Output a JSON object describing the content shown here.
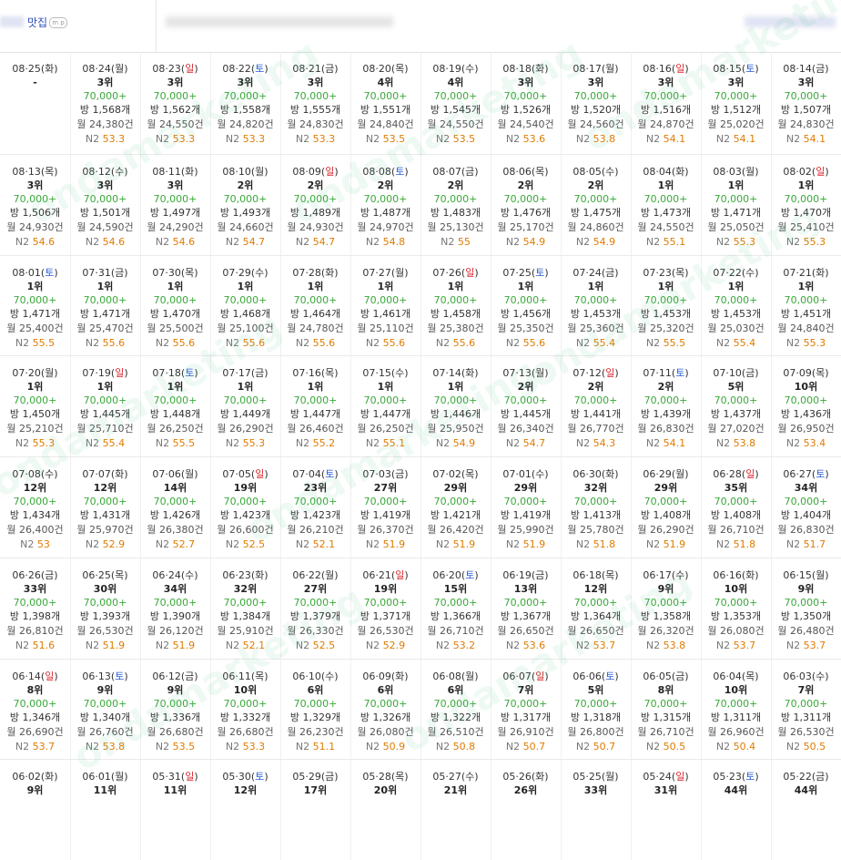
{
  "header": {
    "title": "맛집",
    "badge": "m p"
  },
  "first_row": [
    {
      "date": "08·25(화)",
      "wd": "",
      "rank": "-"
    },
    {
      "date": "08·24(월)",
      "wd": "",
      "rank": "3위",
      "price": "70,000+",
      "bang": "방 1,568개",
      "month": "월 24,380건",
      "n2": "53.3"
    },
    {
      "date": "08·23(",
      "wday": "일",
      ")": ")",
      "wd": "sun",
      "rank": "3위",
      "price": "70,000+",
      "bang": "방 1,562개",
      "month": "월 24,550건",
      "n2": "53.3"
    },
    {
      "date": "08·22(",
      "wday": "토",
      "wd": "sat",
      "rank": "3위",
      "price": "70,000+",
      "bang": "방 1,558개",
      "month": "월 24,820건",
      "n2": "53.3"
    },
    {
      "date": "08·21(금)",
      "wd": "",
      "rank": "3위",
      "price": "70,000+",
      "bang": "방 1,555개",
      "month": "월 24,830건",
      "n2": "53.3"
    },
    {
      "date": "08·20(목)",
      "wd": "",
      "rank": "4위",
      "price": "70,000+",
      "bang": "방 1,551개",
      "month": "월 24,840건",
      "n2": "53.5"
    },
    {
      "date": "08·19(수)",
      "wd": "",
      "rank": "4위",
      "price": "70,000+",
      "bang": "방 1,545개",
      "month": "월 24,550건",
      "n2": "53.5"
    },
    {
      "date": "08·18(화)",
      "wd": "",
      "rank": "3위",
      "price": "70,000+",
      "bang": "방 1,526개",
      "month": "월 24,540건",
      "n2": "53.6"
    },
    {
      "date": "08·17(월)",
      "wd": "",
      "rank": "3위",
      "price": "70,000+",
      "bang": "방 1,520개",
      "month": "월 24,560건",
      "n2": "53.8"
    },
    {
      "date": "08·16(",
      "wday": "일",
      "wd": "sun",
      "rank": "3위",
      "price": "70,000+",
      "bang": "방 1,516개",
      "month": "월 24,870건",
      "n2": "54.1"
    },
    {
      "date": "08·15(",
      "wday": "토",
      "wd": "sat",
      "rank": "3위",
      "price": "70,000+",
      "bang": "방 1,512개",
      "month": "월 25,020건",
      "n2": "54.1"
    },
    {
      "date": "08·14(금)",
      "wd": "",
      "rank": "3위",
      "price": "70,000+",
      "bang": "방 1,507개",
      "month": "월 24,830건",
      "n2": "54.1"
    }
  ],
  "rows": [
    [
      {
        "d": "08·13(목)",
        "w": "",
        "r": "3위",
        "b": "방 1,506개",
        "m": "월 24,930건",
        "n": "54.6"
      },
      {
        "d": "08·12(수)",
        "w": "",
        "r": "3위",
        "b": "방 1,501개",
        "m": "월 24,590건",
        "n": "54.6"
      },
      {
        "d": "08·11(화)",
        "w": "",
        "r": "3위",
        "b": "방 1,497개",
        "m": "월 24,290건",
        "n": "54.6"
      },
      {
        "d": "08·10(월)",
        "w": "",
        "r": "2위",
        "b": "방 1,493개",
        "m": "월 24,660건",
        "n": "54.7"
      },
      {
        "d": "08·09(",
        "w": "sun",
        "r": "2위",
        "b": "방 1,489개",
        "m": "월 24,930건",
        "n": "54.7"
      },
      {
        "d": "08·08(",
        "w": "sat",
        "r": "2위",
        "b": "방 1,487개",
        "m": "월 24,970건",
        "n": "54.8"
      },
      {
        "d": "08·07(금)",
        "w": "",
        "r": "2위",
        "b": "방 1,483개",
        "m": "월 25,130건",
        "n": "55"
      },
      {
        "d": "08·06(목)",
        "w": "",
        "r": "2위",
        "b": "방 1,476개",
        "m": "월 25,170건",
        "n": "54.9"
      },
      {
        "d": "08·05(수)",
        "w": "",
        "r": "2위",
        "b": "방 1,475개",
        "m": "월 24,860건",
        "n": "54.9"
      },
      {
        "d": "08·04(화)",
        "w": "",
        "r": "1위",
        "b": "방 1,473개",
        "m": "월 24,550건",
        "n": "55.1"
      },
      {
        "d": "08·03(월)",
        "w": "",
        "r": "1위",
        "b": "방 1,471개",
        "m": "월 25,050건",
        "n": "55.3"
      },
      {
        "d": "08·02(",
        "w": "sun",
        "r": "1위",
        "b": "방 1,470개",
        "m": "월 25,410건",
        "n": "55.3"
      }
    ],
    [
      {
        "d": "08·01(",
        "w": "sat",
        "r": "1위",
        "b": "방 1,471개",
        "m": "월 25,400건",
        "n": "55.5"
      },
      {
        "d": "07·31(금)",
        "w": "",
        "r": "1위",
        "b": "방 1,471개",
        "m": "월 25,470건",
        "n": "55.6"
      },
      {
        "d": "07·30(목)",
        "w": "",
        "r": "1위",
        "b": "방 1,470개",
        "m": "월 25,500건",
        "n": "55.6"
      },
      {
        "d": "07·29(수)",
        "w": "",
        "r": "1위",
        "b": "방 1,468개",
        "m": "월 25,100건",
        "n": "55.6"
      },
      {
        "d": "07·28(화)",
        "w": "",
        "r": "1위",
        "b": "방 1,464개",
        "m": "월 24,780건",
        "n": "55.6"
      },
      {
        "d": "07·27(월)",
        "w": "",
        "r": "1위",
        "b": "방 1,461개",
        "m": "월 25,110건",
        "n": "55.6"
      },
      {
        "d": "07·26(",
        "w": "sun",
        "r": "1위",
        "b": "방 1,458개",
        "m": "월 25,380건",
        "n": "55.6"
      },
      {
        "d": "07·25(",
        "w": "sat",
        "r": "1위",
        "b": "방 1,456개",
        "m": "월 25,350건",
        "n": "55.6"
      },
      {
        "d": "07·24(금)",
        "w": "",
        "r": "1위",
        "b": "방 1,453개",
        "m": "월 25,360건",
        "n": "55.4"
      },
      {
        "d": "07·23(목)",
        "w": "",
        "r": "1위",
        "b": "방 1,453개",
        "m": "월 25,320건",
        "n": "55.5"
      },
      {
        "d": "07·22(수)",
        "w": "",
        "r": "1위",
        "b": "방 1,453개",
        "m": "월 25,030건",
        "n": "55.4"
      },
      {
        "d": "07·21(화)",
        "w": "",
        "r": "1위",
        "b": "방 1,451개",
        "m": "월 24,840건",
        "n": "55.3"
      }
    ],
    [
      {
        "d": "07·20(월)",
        "w": "",
        "r": "1위",
        "b": "방 1,450개",
        "m": "월 25,210건",
        "n": "55.3"
      },
      {
        "d": "07·19(",
        "w": "sun",
        "r": "1위",
        "b": "방 1,445개",
        "m": "월 25,710건",
        "n": "55.4"
      },
      {
        "d": "07·18(",
        "w": "sat",
        "r": "1위",
        "b": "방 1,448개",
        "m": "월 26,250건",
        "n": "55.5"
      },
      {
        "d": "07·17(금)",
        "w": "",
        "r": "1위",
        "b": "방 1,449개",
        "m": "월 26,290건",
        "n": "55.3"
      },
      {
        "d": "07·16(목)",
        "w": "",
        "r": "1위",
        "b": "방 1,447개",
        "m": "월 26,460건",
        "n": "55.2"
      },
      {
        "d": "07·15(수)",
        "w": "",
        "r": "1위",
        "b": "방 1,447개",
        "m": "월 26,250건",
        "n": "55.1"
      },
      {
        "d": "07·14(화)",
        "w": "",
        "r": "1위",
        "b": "방 1,446개",
        "m": "월 25,950건",
        "n": "54.9"
      },
      {
        "d": "07·13(월)",
        "w": "",
        "r": "2위",
        "b": "방 1,445개",
        "m": "월 26,340건",
        "n": "54.7"
      },
      {
        "d": "07·12(",
        "w": "sun",
        "r": "2위",
        "b": "방 1,441개",
        "m": "월 26,770건",
        "n": "54.3"
      },
      {
        "d": "07·11(",
        "w": "sat",
        "r": "2위",
        "b": "방 1,439개",
        "m": "월 26,830건",
        "n": "54.1"
      },
      {
        "d": "07·10(금)",
        "w": "",
        "r": "5위",
        "b": "방 1,437개",
        "m": "월 27,020건",
        "n": "53.8"
      },
      {
        "d": "07·09(목)",
        "w": "",
        "r": "10위",
        "b": "방 1,436개",
        "m": "월 26,950건",
        "n": "53.4"
      }
    ],
    [
      {
        "d": "07·08(수)",
        "w": "",
        "r": "12위",
        "b": "방 1,434개",
        "m": "월 26,400건",
        "n": "53"
      },
      {
        "d": "07·07(화)",
        "w": "",
        "r": "12위",
        "b": "방 1,431개",
        "m": "월 25,970건",
        "n": "52.9"
      },
      {
        "d": "07·06(월)",
        "w": "",
        "r": "14위",
        "b": "방 1,426개",
        "m": "월 26,380건",
        "n": "52.7"
      },
      {
        "d": "07·05(",
        "w": "sun",
        "r": "19위",
        "b": "방 1,423개",
        "m": "월 26,600건",
        "n": "52.5"
      },
      {
        "d": "07·04(",
        "w": "sat",
        "r": "23위",
        "b": "방 1,423개",
        "m": "월 26,210건",
        "n": "52.1"
      },
      {
        "d": "07·03(금)",
        "w": "",
        "r": "27위",
        "b": "방 1,419개",
        "m": "월 26,370건",
        "n": "51.9"
      },
      {
        "d": "07·02(목)",
        "w": "",
        "r": "29위",
        "b": "방 1,421개",
        "m": "월 26,420건",
        "n": "51.9"
      },
      {
        "d": "07·01(수)",
        "w": "",
        "r": "29위",
        "b": "방 1,419개",
        "m": "월 25,990건",
        "n": "51.9"
      },
      {
        "d": "06·30(화)",
        "w": "",
        "r": "32위",
        "b": "방 1,413개",
        "m": "월 25,780건",
        "n": "51.8"
      },
      {
        "d": "06·29(월)",
        "w": "",
        "r": "29위",
        "b": "방 1,408개",
        "m": "월 26,290건",
        "n": "51.9"
      },
      {
        "d": "06·28(",
        "w": "sun",
        "r": "35위",
        "b": "방 1,408개",
        "m": "월 26,710건",
        "n": "51.8"
      },
      {
        "d": "06·27(",
        "w": "sat",
        "r": "34위",
        "b": "방 1,404개",
        "m": "월 26,830건",
        "n": "51.7"
      }
    ],
    [
      {
        "d": "06·26(금)",
        "w": "",
        "r": "33위",
        "b": "방 1,398개",
        "m": "월 26,810건",
        "n": "51.6"
      },
      {
        "d": "06·25(목)",
        "w": "",
        "r": "30위",
        "b": "방 1,393개",
        "m": "월 26,530건",
        "n": "51.9"
      },
      {
        "d": "06·24(수)",
        "w": "",
        "r": "34위",
        "b": "방 1,390개",
        "m": "월 26,120건",
        "n": "51.9"
      },
      {
        "d": "06·23(화)",
        "w": "",
        "r": "32위",
        "b": "방 1,384개",
        "m": "월 25,910건",
        "n": "52.1"
      },
      {
        "d": "06·22(월)",
        "w": "",
        "r": "27위",
        "b": "방 1,379개",
        "m": "월 26,330건",
        "n": "52.5"
      },
      {
        "d": "06·21(",
        "w": "sun",
        "r": "19위",
        "b": "방 1,371개",
        "m": "월 26,530건",
        "n": "52.9"
      },
      {
        "d": "06·20(",
        "w": "sat",
        "r": "15위",
        "b": "방 1,366개",
        "m": "월 26,710건",
        "n": "53.2"
      },
      {
        "d": "06·19(금)",
        "w": "",
        "r": "13위",
        "b": "방 1,367개",
        "m": "월 26,650건",
        "n": "53.6"
      },
      {
        "d": "06·18(목)",
        "w": "",
        "r": "12위",
        "b": "방 1,364개",
        "m": "월 26,650건",
        "n": "53.7"
      },
      {
        "d": "06·17(수)",
        "w": "",
        "r": "9위",
        "b": "방 1,358개",
        "m": "월 26,320건",
        "n": "53.8"
      },
      {
        "d": "06·16(화)",
        "w": "",
        "r": "10위",
        "b": "방 1,353개",
        "m": "월 26,080건",
        "n": "53.7"
      },
      {
        "d": "06·15(월)",
        "w": "",
        "r": "9위",
        "b": "방 1,350개",
        "m": "월 26,480건",
        "n": "53.7"
      }
    ],
    [
      {
        "d": "06·14(",
        "w": "sun",
        "r": "8위",
        "b": "방 1,346개",
        "m": "월 26,690건",
        "n": "53.7"
      },
      {
        "d": "06·13(",
        "w": "sat",
        "r": "9위",
        "b": "방 1,340개",
        "m": "월 26,760건",
        "n": "53.8"
      },
      {
        "d": "06·12(금)",
        "w": "",
        "r": "9위",
        "b": "방 1,336개",
        "m": "월 26,680건",
        "n": "53.5"
      },
      {
        "d": "06·11(목)",
        "w": "",
        "r": "10위",
        "b": "방 1,332개",
        "m": "월 26,680건",
        "n": "53.3"
      },
      {
        "d": "06·10(수)",
        "w": "",
        "r": "6위",
        "b": "방 1,329개",
        "m": "월 26,230건",
        "n": "51.1"
      },
      {
        "d": "06·09(화)",
        "w": "",
        "r": "6위",
        "b": "방 1,326개",
        "m": "월 26,080건",
        "n": "50.9"
      },
      {
        "d": "06·08(월)",
        "w": "",
        "r": "6위",
        "b": "방 1,322개",
        "m": "월 26,510건",
        "n": "50.8"
      },
      {
        "d": "06·07(",
        "w": "sun",
        "r": "7위",
        "b": "방 1,317개",
        "m": "월 26,910건",
        "n": "50.7"
      },
      {
        "d": "06·06(",
        "w": "sat",
        "r": "5위",
        "b": "방 1,318개",
        "m": "월 26,800건",
        "n": "50.7"
      },
      {
        "d": "06·05(금)",
        "w": "",
        "r": "8위",
        "b": "방 1,315개",
        "m": "월 26,710건",
        "n": "50.5"
      },
      {
        "d": "06·04(목)",
        "w": "",
        "r": "10위",
        "b": "방 1,311개",
        "m": "월 26,960건",
        "n": "50.4"
      },
      {
        "d": "06·03(수)",
        "w": "",
        "r": "7위",
        "b": "방 1,311개",
        "m": "월 26,530건",
        "n": "50.5"
      }
    ],
    [
      {
        "d": "06·02(화)",
        "w": "",
        "r": "9위"
      },
      {
        "d": "06·01(월)",
        "w": "",
        "r": "11위"
      },
      {
        "d": "05·31(",
        "w": "sun",
        "r": "11위"
      },
      {
        "d": "05·30(",
        "w": "sat",
        "r": "12위"
      },
      {
        "d": "05·29(금)",
        "w": "",
        "r": "17위"
      },
      {
        "d": "05·28(목)",
        "w": "",
        "r": "20위"
      },
      {
        "d": "05·27(수)",
        "w": "",
        "r": "21위"
      },
      {
        "d": "05·26(화)",
        "w": "",
        "r": "26위"
      },
      {
        "d": "05·25(월)",
        "w": "",
        "r": "33위"
      },
      {
        "d": "05·24(",
        "w": "sun",
        "r": "31위"
      },
      {
        "d": "05·23(",
        "w": "sat",
        "r": "44위"
      },
      {
        "d": "05·22(금)",
        "w": "",
        "r": "44위"
      }
    ]
  ],
  "labels": {
    "price": "70,000+",
    "n2_prefix": "N2 ",
    "sun": "일",
    "sat": "토",
    "close": ")"
  },
  "watermark": "ondamarketing",
  "colors": {
    "price": "#3aa83a",
    "n2": "#e07b00",
    "sun": "#d9262d",
    "sat": "#2a5cd4"
  }
}
